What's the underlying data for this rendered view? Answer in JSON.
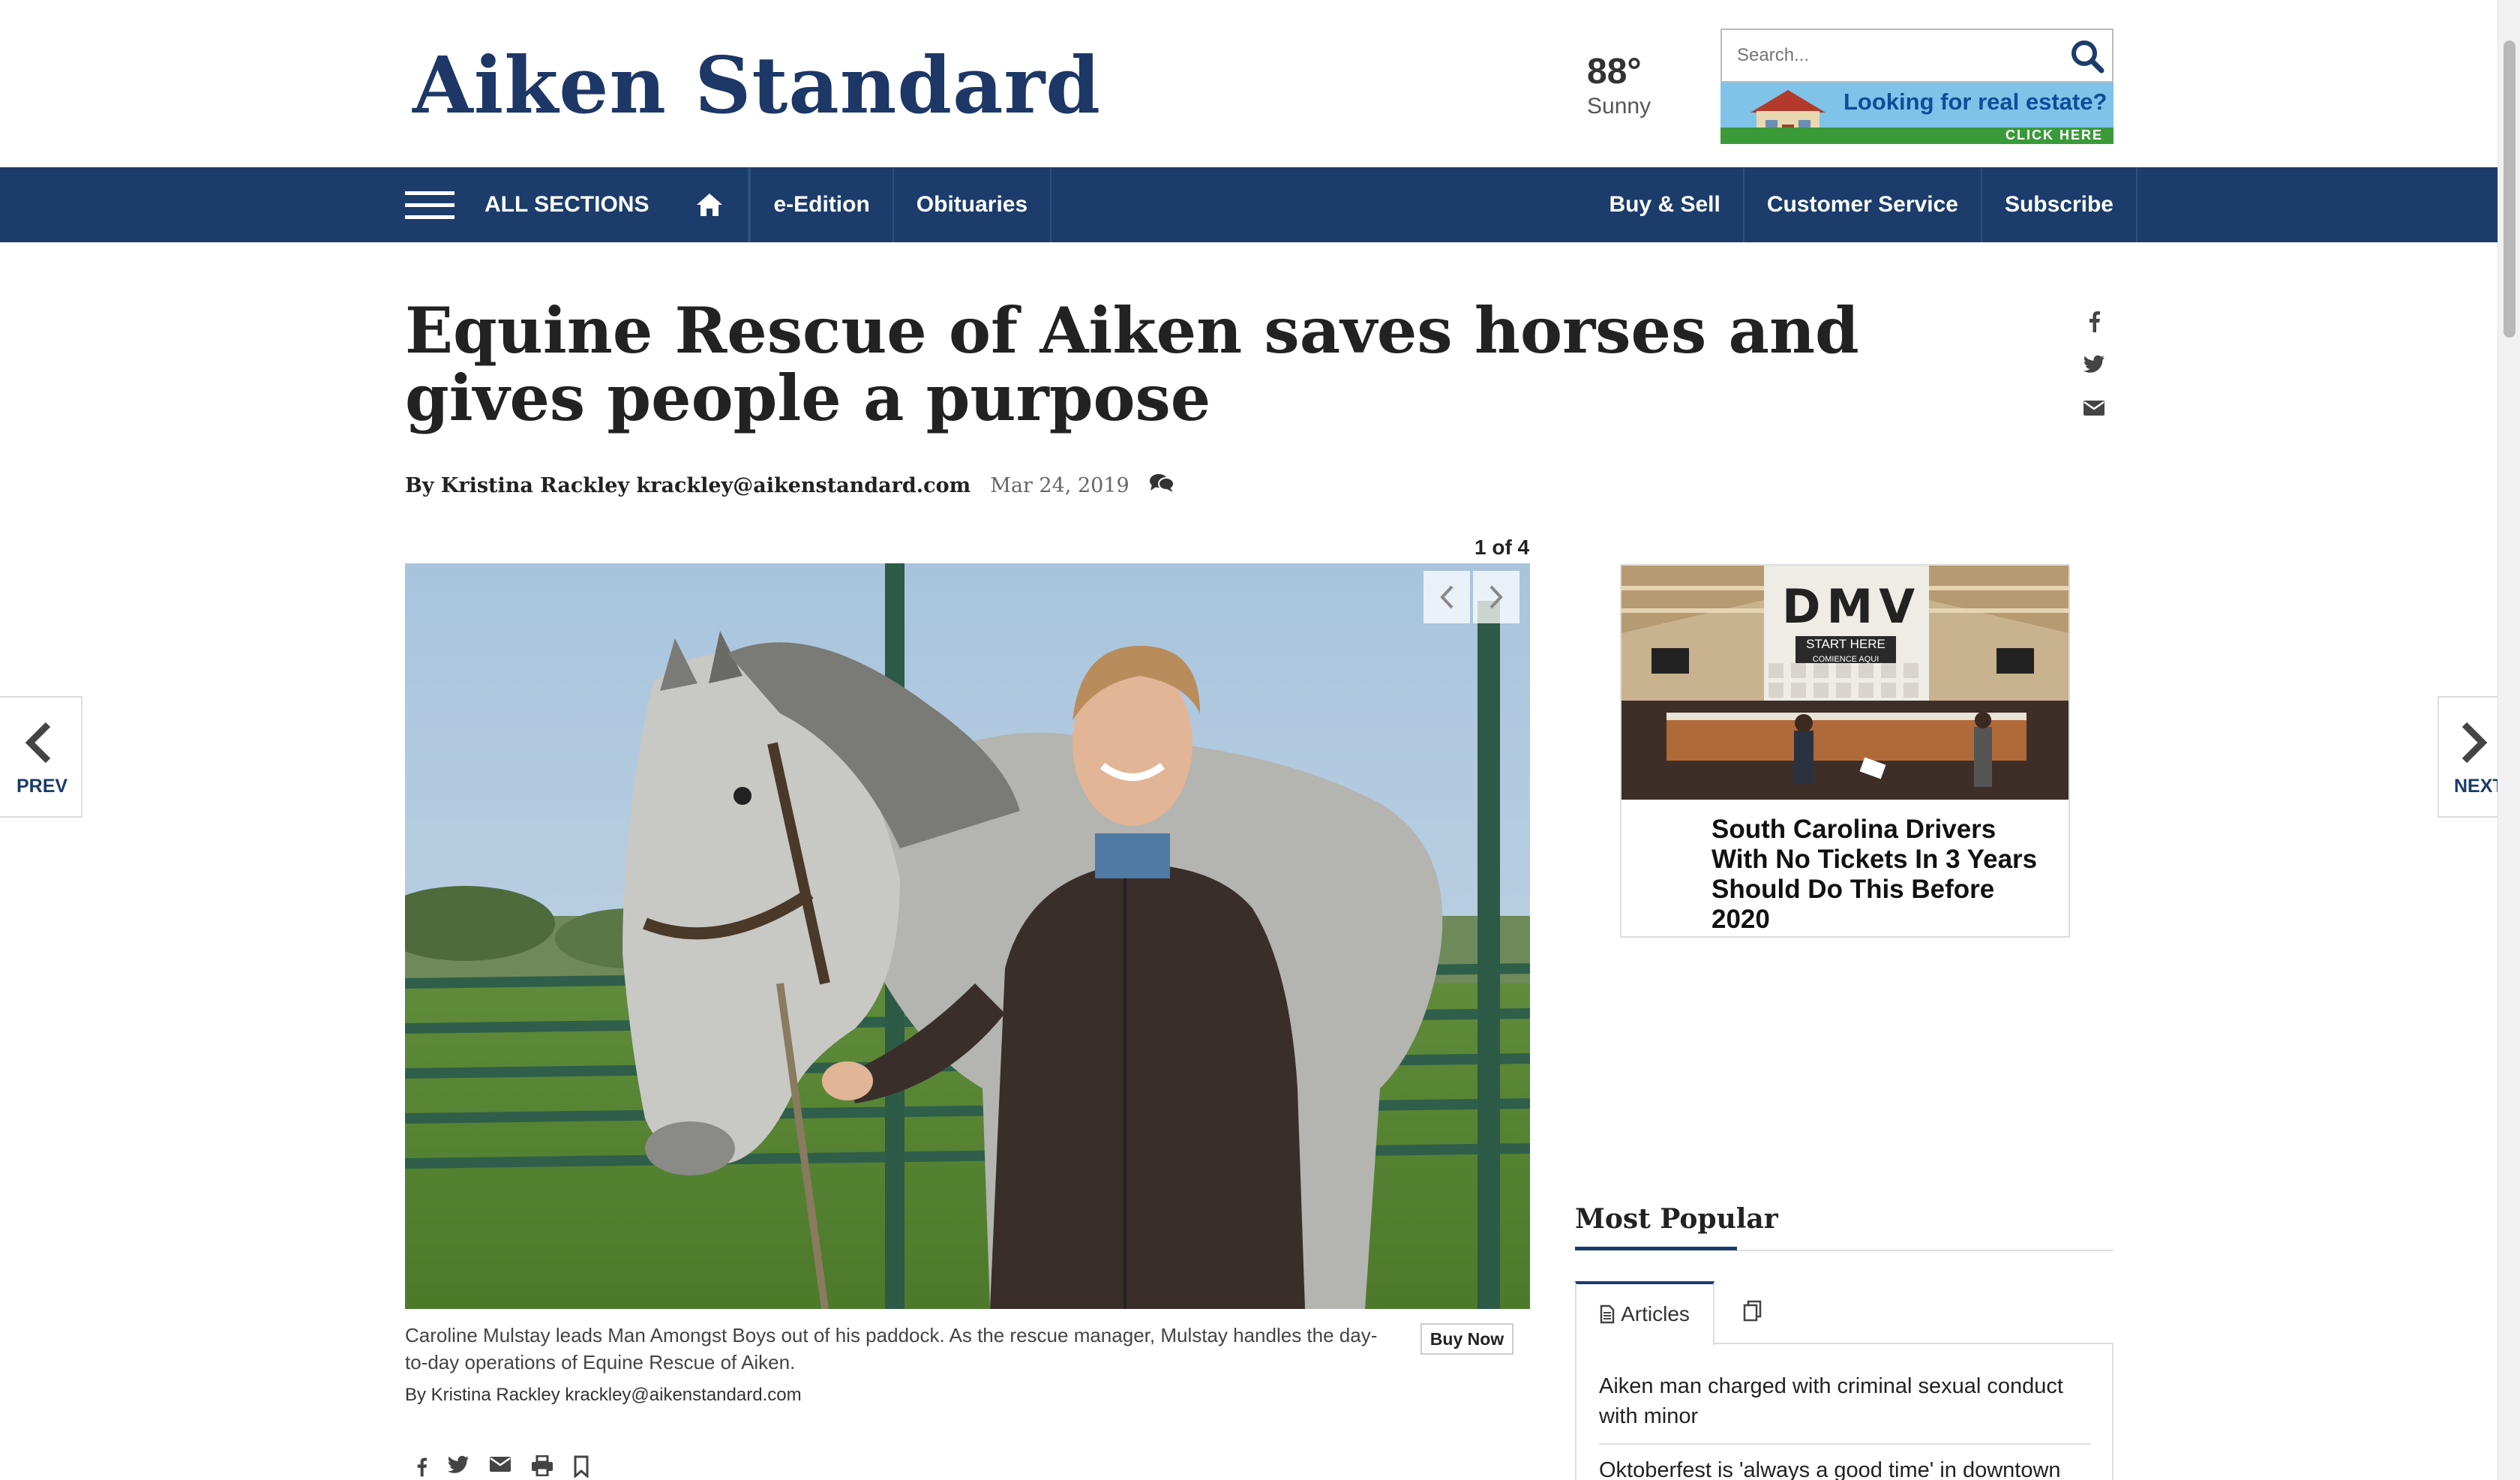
{
  "site": {
    "logo": "Aiken Standard",
    "weather_temp": "88°",
    "weather_condition": "Sunny",
    "search_placeholder": "Search...",
    "ad_real_estate": "Looking for real estate?",
    "ad_click_here": "CLICK HERE"
  },
  "nav": {
    "all_sections": "ALL SECTIONS",
    "left_items": [
      "e-Edition",
      "Obituaries"
    ],
    "right_items": [
      "Buy & Sell",
      "Customer Service",
      "Subscribe"
    ]
  },
  "article": {
    "headline": "Equine Rescue of Aiken saves horses and gives people a purpose",
    "author": "By Kristina Rackley krackley@aikenstandard.com",
    "date": "Mar 24, 2019",
    "gallery_counter": "1 of 4",
    "caption": "Caroline Mulstay leads Man Amongst Boys out of his paddock. As the rescue manager, Mulstay handles the day-to-day operations of Equine Rescue of Aiken.",
    "photo_credit": "By Kristina Rackley krackley@aikenstandard.com",
    "buy_now": "Buy Now"
  },
  "side_nav": {
    "prev": "PREV",
    "next": "NEXT"
  },
  "ad_dmv": {
    "sign": "DMV",
    "start_here": "START HERE",
    "comience": "COMIENCE AQUI",
    "headline": "South Carolina Drivers With No Tickets In 3 Years Should Do This Before 2020"
  },
  "most_popular": {
    "title": "Most Popular",
    "tab_articles": "Articles",
    "items": [
      "Aiken man charged with criminal sexual conduct with minor",
      "Oktoberfest is 'always a good time' in downtown"
    ]
  },
  "colors": {
    "nav_bg": "#1c3c6b",
    "logo": "#1d3766"
  },
  "icons": [
    "search-icon",
    "home-icon",
    "facebook-icon",
    "twitter-icon",
    "email-icon",
    "comment-icon",
    "chevron-left-icon",
    "chevron-right-icon",
    "print-icon",
    "bookmark-icon",
    "document-icon",
    "copy-icon"
  ]
}
